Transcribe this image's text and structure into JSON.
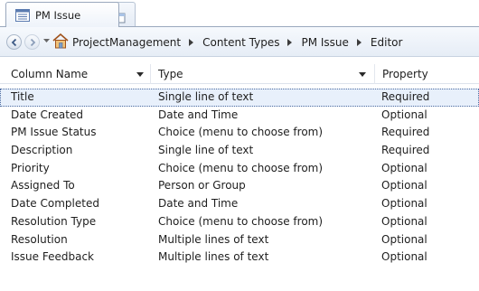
{
  "tabs": [
    {
      "label": "PM Issue",
      "icon": "list-icon"
    },
    {
      "label": "",
      "icon": "new-tab-icon"
    }
  ],
  "breadcrumb": {
    "items": [
      "ProjectManagement",
      "Content Types",
      "PM Issue",
      "Editor"
    ]
  },
  "columns": {
    "name": "Column Name",
    "type": "Type",
    "property": "Property"
  },
  "rows": [
    {
      "name": "Title",
      "type": "Single line of text",
      "property": "Required",
      "selected": true
    },
    {
      "name": "Date Created",
      "type": "Date and Time",
      "property": "Optional"
    },
    {
      "name": "PM Issue Status",
      "type": "Choice (menu to choose from)",
      "property": "Required"
    },
    {
      "name": "Description",
      "type": "Single line of text",
      "property": "Required"
    },
    {
      "name": "Priority",
      "type": "Choice (menu to choose from)",
      "property": "Optional"
    },
    {
      "name": "Assigned To",
      "type": "Person or Group",
      "property": "Optional"
    },
    {
      "name": "Date Completed",
      "type": "Date and Time",
      "property": "Optional"
    },
    {
      "name": "Resolution Type",
      "type": "Choice (menu to choose from)",
      "property": "Optional"
    },
    {
      "name": "Resolution",
      "type": "Multiple lines of text",
      "property": "Optional"
    },
    {
      "name": "Issue Feedback",
      "type": "Multiple lines of text",
      "property": "Optional"
    }
  ],
  "colors": {
    "selection_bg": "#e8f0fb",
    "tab_border": "#9aa8bd",
    "navbar_bg": "#eef3fa"
  }
}
